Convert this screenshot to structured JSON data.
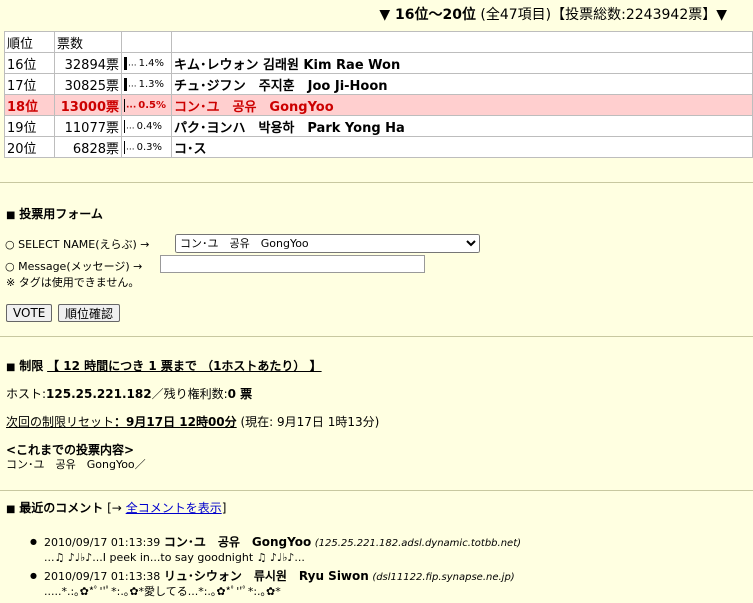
{
  "header": {
    "range": "▼ 16位～20位",
    "items": "(全47項目)",
    "total": "【投票総数:2243942票】▼"
  },
  "table": {
    "columns": [
      "順位",
      "票数",
      "",
      ""
    ],
    "rows": [
      {
        "rank": "16位",
        "votes": "32894票",
        "pct": "1.4%",
        "bar": "thick",
        "name": "キム･レウォン 김래원 Kim Rae Won",
        "highlight": false
      },
      {
        "rank": "17位",
        "votes": "30825票",
        "pct": "1.3%",
        "bar": "thick",
        "name": "チュ･ジフン　주지훈　Joo Ji-Hoon",
        "highlight": false
      },
      {
        "rank": "18位",
        "votes": "13000票",
        "pct": "0.5%",
        "bar": "thin",
        "name": "コン･ユ　공유　GongYoo",
        "highlight": true
      },
      {
        "rank": "19位",
        "votes": "11077票",
        "pct": "0.4%",
        "bar": "thin",
        "name": "パク･ヨンハ　박용하　Park Yong Ha",
        "highlight": false
      },
      {
        "rank": "20位",
        "votes": "6828票",
        "pct": "0.3%",
        "bar": "thin",
        "name": "コ･ス",
        "highlight": false
      }
    ]
  },
  "vote_form": {
    "title": "投票用フォーム",
    "select_label": "SELECT NAME(えらぶ) →",
    "select_value": "コン･ユ　공유　GongYoo",
    "message_label": "Message(メッセージ) →",
    "message_value": "",
    "note": "※ タグは使用できません。",
    "vote_button": "VOTE",
    "rank_button": "順位確認"
  },
  "limit": {
    "title": "制限",
    "detail": "【 12 時間につき 1 票まで （1ホストあたり） 】",
    "host_label": "ホスト:",
    "host_value": "125.25.221.182",
    "remain_label": "／残り権利数:",
    "remain_value": "0 票",
    "reset_label": "次回の制限リセット",
    "reset_value": "：9月17日 12時00分",
    "now": "(現在: 9月17日 1時13分)",
    "history_title": "<これまでの投票内容>",
    "history_value": "コン･ユ　공유　GongYoo／"
  },
  "comments": {
    "title": "最近のコメント",
    "link_prefix": "[→ ",
    "link_label": "全コメントを表示",
    "link_suffix": "]",
    "items": [
      {
        "time": "2010/09/17 01:13:39",
        "name": "コン･ユ　공유　GongYoo",
        "host": "(125.25.221.182.adsl.dynamic.totbb.net)",
        "text": "...♫ ♪♩♭♪...I peek in...to say goodnight ♫ ♪♩♭♪..."
      },
      {
        "time": "2010/09/17 01:13:38",
        "name": "リュ･シウォン　류시원　Ryu Siwon",
        "host": "(dsl11122.fip.synapse.ne.jp)",
        "text": ".....*.:｡✿*ﾟ''ﾟ*:.｡✿*愛してる...*:.｡✿*ﾟ''ﾟ*:.｡✿*"
      }
    ]
  }
}
